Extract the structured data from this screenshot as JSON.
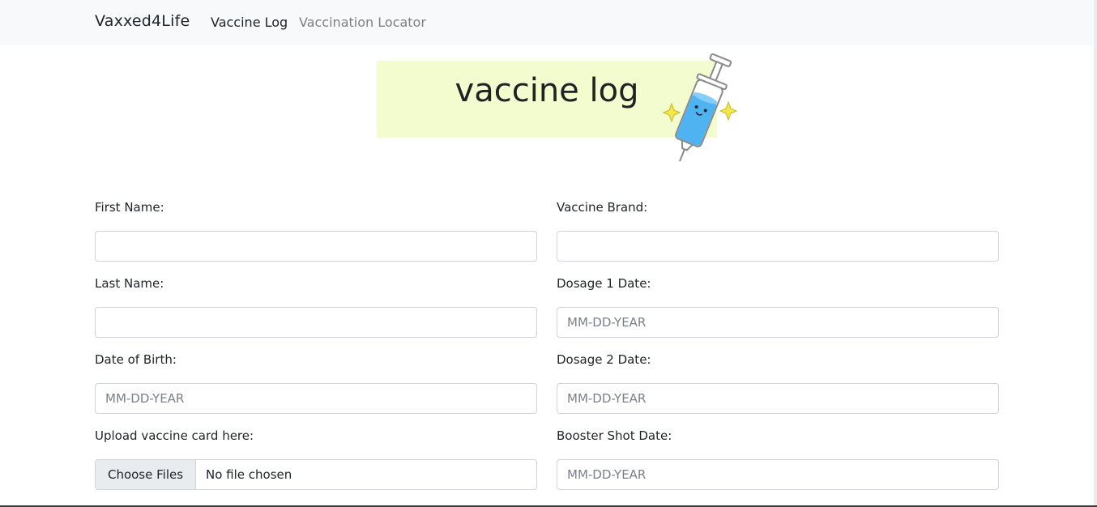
{
  "navbar": {
    "brand": "Vaxxed4Life",
    "links": [
      {
        "label": "Vaccine Log",
        "active": true
      },
      {
        "label": "Vaccination Locator",
        "active": false
      }
    ]
  },
  "hero": {
    "title": "vaccine log",
    "background_color": "#f2fcce",
    "illustration": "syringe-mascot-icon"
  },
  "form": {
    "left": {
      "first_name": {
        "label": "First Name:",
        "value": ""
      },
      "last_name": {
        "label": "Last Name:",
        "value": ""
      },
      "dob": {
        "label": "Date of Birth:",
        "placeholder": "MM-DD-YEAR",
        "value": ""
      },
      "upload": {
        "label": "Upload vaccine card here:",
        "button": "Choose Files",
        "status": "No file chosen"
      }
    },
    "right": {
      "brand": {
        "label": "Vaccine Brand:",
        "value": ""
      },
      "dose1": {
        "label": "Dosage 1 Date:",
        "placeholder": "MM-DD-YEAR",
        "value": ""
      },
      "dose2": {
        "label": "Dosage 2 Date:",
        "placeholder": "MM-DD-YEAR",
        "value": ""
      },
      "booster": {
        "label": "Booster Shot Date:",
        "placeholder": "MM-DD-YEAR",
        "value": ""
      }
    }
  }
}
